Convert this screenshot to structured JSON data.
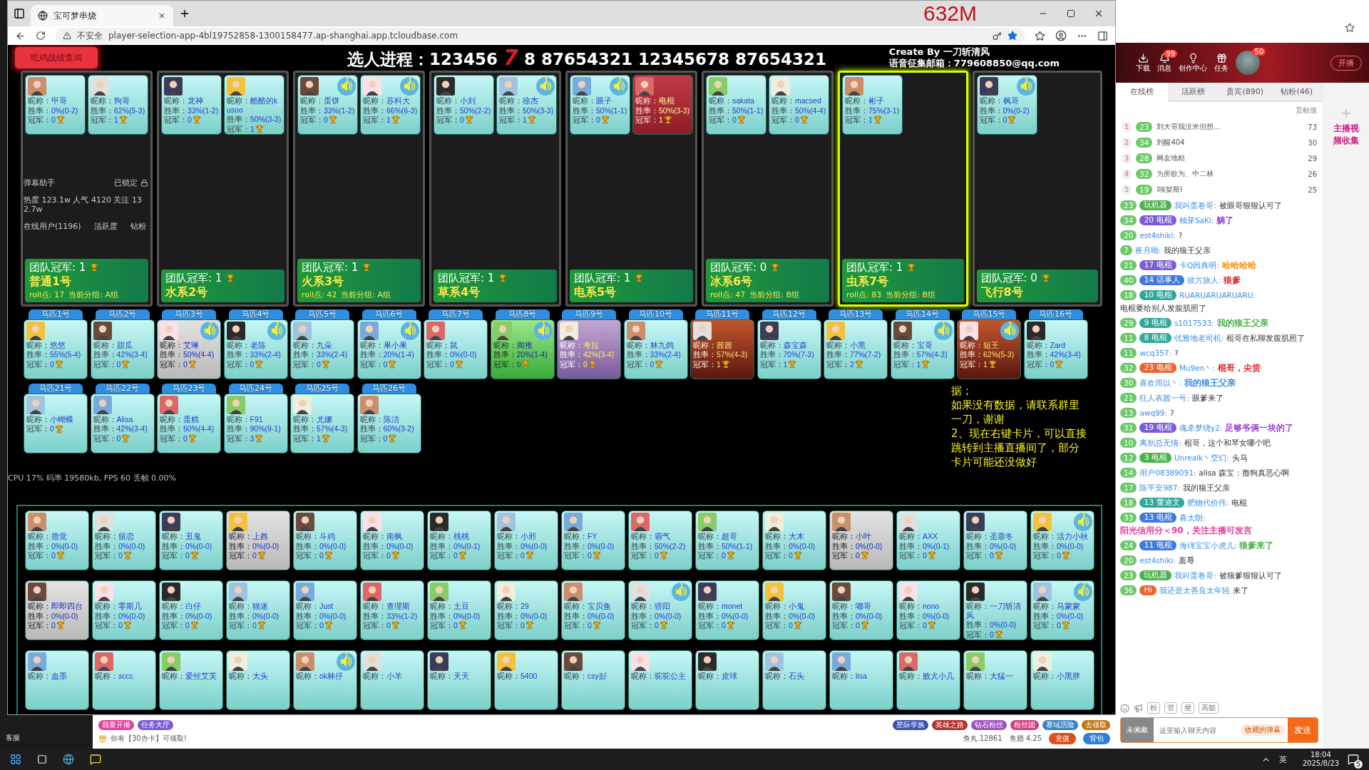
{
  "browser": {
    "tab_title": "宝可梦串烧",
    "memory_overlay": "632M",
    "security": "不安全",
    "url": "player-selection-app-4bl19752858-1300158477.ap-shanghai.app.tcloudbase.com"
  },
  "page": {
    "query_button": "吃鸡战绩查询",
    "progress_label": "选人进程：",
    "progress": [
      {
        "text": "123456",
        "highlight": false
      },
      {
        "text": "7",
        "highlight": true
      },
      {
        "text": "8 87654321 12345678 87654321",
        "highlight": false
      }
    ],
    "credit": "Create By 一刀斩清风",
    "email": "语音征集邮箱：779608850@qq.com"
  },
  "teams": [
    {
      "name": "普通1号",
      "champion": "团队冠军: 1",
      "roll": "roll点: 17",
      "group": "当前分组: A组",
      "selected": false,
      "players": [
        {
          "nick": "昵称：甲哥",
          "rate": "胜率：0%(0-2)",
          "champ": "冠军：0",
          "kind": "plain"
        },
        {
          "nick": "昵称：狗哥",
          "rate": "胜率：62%(5-3)",
          "champ": "冠军：1",
          "kind": "plain"
        }
      ]
    },
    {
      "name": "水系2号",
      "champion": "团队冠军: 1",
      "selected": false,
      "players": [
        {
          "nick": "昵称：龙神",
          "rate": "胜率：33%(1-2)",
          "champ": "冠军：0",
          "kind": "plain"
        },
        {
          "nick": "昵称：酷酷的kusoo",
          "rate": "胜率：50%(3-3)",
          "champ": "冠军：1",
          "kind": "plain"
        }
      ]
    },
    {
      "name": "火系3号",
      "champion": "团队冠军: 1",
      "roll": "roll点: 42",
      "group": "当前分组: A组",
      "selected": false,
      "players": [
        {
          "nick": "昵称：蛋饼",
          "rate": "胜率：33%(1-2)",
          "champ": "冠军：0",
          "voice": "1",
          "kind": "plain"
        },
        {
          "nick": "昵称：苏科大",
          "rate": "胜率：66%(6-3)",
          "champ": "冠军：1",
          "voice": "1",
          "kind": "plain"
        }
      ]
    },
    {
      "name": "草系4号",
      "champion": "团队冠军: 1",
      "selected": false,
      "players": [
        {
          "nick": "昵称：小刘",
          "rate": "胜率：50%(2-2)",
          "champ": "冠军：0",
          "kind": "plain"
        },
        {
          "nick": "昵称：徐杰",
          "rate": "胜率：50%(3-3)",
          "champ": "冠军：1",
          "voice": "1",
          "kind": "plain"
        }
      ]
    },
    {
      "name": "电系5号",
      "champion": "团队冠军: 1",
      "selected": false,
      "players": [
        {
          "nick": "昵称：眼子",
          "rate": "胜率：50%(1-1)",
          "champ": "冠军：0",
          "voice": "3",
          "kind": "plain"
        },
        {
          "nick": "昵称：电棍",
          "rate": "胜率：50%(3-3)",
          "champ": "冠军：1",
          "kind": "red"
        }
      ]
    },
    {
      "name": "冰系6号",
      "champion": "团队冠军: 0",
      "roll": "roll点: 47",
      "group": "当前分组: B组",
      "selected": false,
      "players": [
        {
          "nick": "昵称：sakata",
          "rate": "胜率：50%(1-1)",
          "champ": "冠军：0",
          "kind": "plain"
        },
        {
          "nick": "昵称：macsed",
          "rate": "胜率：50%(4-4)",
          "champ": "冠军：0",
          "kind": "plain"
        }
      ]
    },
    {
      "name": "虫系7号",
      "champion": "团队冠军: 1",
      "roll": "roll点: 83",
      "group": "当前分组: B组",
      "selected": true,
      "players": [
        {
          "nick": "昵称：彬子",
          "rate": "胜率：75%(3-1)",
          "champ": "冠军：1",
          "kind": "plain"
        }
      ]
    },
    {
      "name": "飞行8号",
      "champion": "团队冠军: 0",
      "selected": false,
      "players": [
        {
          "nick": "昵称：枫哥",
          "rate": "胜率：0%(0-2)",
          "champ": "冠军：0",
          "voice": "1",
          "kind": "plain"
        }
      ]
    }
  ],
  "horses": [
    {
      "tab": "马匹1号",
      "nick": "昵称：悠悠",
      "rate": "胜率：55%(5-4)",
      "champ": "冠军：0",
      "kind": "plain"
    },
    {
      "tab": "马匹2号",
      "nick": "昵称：甜瓜",
      "rate": "胜率：42%(3-4)",
      "champ": "冠军：0",
      "kind": "plain"
    },
    {
      "tab": "马匹3号",
      "nick": "昵称：艾琳",
      "rate": "胜率：50%(4-4)",
      "champ": "冠军：0",
      "voice": "2",
      "kind": "grey"
    },
    {
      "tab": "马匹4号",
      "nick": "昵称：老陈",
      "rate": "胜率：33%(2-4)",
      "champ": "冠军：0",
      "voice": "2",
      "kind": "plain"
    },
    {
      "tab": "马匹5号",
      "nick": "昵称：九朵",
      "rate": "胜率：33%(2-4)",
      "champ": "冠军：0",
      "kind": "plain"
    },
    {
      "tab": "马匹6号",
      "nick": "昵称：果小果",
      "rate": "胜率：20%(1-4)",
      "champ": "冠军：0",
      "voice": "1",
      "kind": "plain"
    },
    {
      "tab": "马匹7号",
      "nick": "昵称：鼠",
      "rate": "胜率：0%(0-0)",
      "champ": "冠军：0",
      "kind": "plain"
    },
    {
      "tab": "马匹8号",
      "nick": "昵称：闻推",
      "rate": "胜率：20%(1-4)",
      "champ": "冠军：0",
      "voice": "1",
      "kind": "green"
    },
    {
      "tab": "马匹9号",
      "nick": "昵称：考拉",
      "rate": "胜率：42%(3-4)",
      "champ": "冠军：0",
      "kind": "purple"
    },
    {
      "tab": "马匹10号",
      "nick": "昵称：林九鸽",
      "rate": "胜率：33%(2-4)",
      "champ": "冠军：0",
      "kind": "plain"
    },
    {
      "tab": "马匹11号",
      "nick": "昵称：茜茜",
      "rate": "胜率：57%(4-3)",
      "champ": "冠军：1",
      "kind": "fire"
    },
    {
      "tab": "马匹12号",
      "nick": "昵称：森宝森",
      "rate": "胜率：70%(7-3)",
      "champ": "冠军：1",
      "kind": "plain"
    },
    {
      "tab": "马匹13号",
      "nick": "昵称：小黑",
      "rate": "胜率：77%(7-2)",
      "champ": "冠军：2",
      "kind": "plain"
    },
    {
      "tab": "马匹14号",
      "nick": "昵称：宝哥",
      "rate": "胜率：57%(4-3)",
      "champ": "冠军：1",
      "voice": "1",
      "kind": "plain"
    },
    {
      "tab": "马匹15号",
      "nick": "昵称：短王",
      "rate": "胜率：62%(5-3)",
      "champ": "冠军：1",
      "voice": "1",
      "kind": "fire"
    },
    {
      "tab": "马匹16号",
      "nick": "昵称：Zard",
      "rate": "胜率：42%(3-4)",
      "champ": "冠军：0",
      "kind": "plain"
    }
  ],
  "horses_2": [
    {
      "tab": "马匹21号",
      "nick": "昵称：小蝴蝶",
      "champ": "冠军：0",
      "kind": "plain"
    },
    {
      "tab": "马匹22号",
      "nick": "昵称：Alisa",
      "rate": "胜率：42%(3-4)",
      "champ": "冠军：0",
      "kind": "plain"
    },
    {
      "tab": "马匹23号",
      "nick": "昵称：蛋糕",
      "rate": "胜率：50%(4-4)",
      "champ": "冠军：0",
      "kind": "plain"
    },
    {
      "tab": "马匹24号",
      "nick": "昵称：F91",
      "rate": "胜率：90%(9-1)",
      "champ": "冠军：3",
      "kind": "plain"
    },
    {
      "tab": "马匹25号",
      "nick": "昵称：尤娜",
      "rate": "胜率：57%(4-3)",
      "champ": "冠军：1",
      "kind": "plain"
    },
    {
      "tab": "马匹26号",
      "nick": "昵称：陈洁",
      "rate": "胜率：60%(3-2)",
      "champ": "冠军：0",
      "kind": "plain"
    }
  ],
  "notice": [
    "据；",
    "如果没有数据，请联系群里一刀，谢谢",
    "2、现在右键卡片，可以直接跳转到主播直播间了，部分卡片可能还没做好"
  ],
  "pool": [
    {
      "nick": "昵称：措觉",
      "rate": "胜率：0%(0-0)",
      "champ": "冠军：0",
      "kind": "plain"
    },
    {
      "nick": "昵称：留恋",
      "rate": "胜率：0%(0-0)",
      "champ": "冠军：0",
      "kind": "plain"
    },
    {
      "nick": "昵称：丑鬼",
      "rate": "胜率：0%(0-0)",
      "champ": "冠军：0",
      "kind": "plain"
    },
    {
      "nick": "昵称：上酋",
      "rate": "胜率：0%(0-0)",
      "champ": "冠军：0",
      "kind": "grey"
    },
    {
      "nick": "昵称：斗鸡",
      "rate": "胜率：0%(0-0)",
      "champ": "冠军：0",
      "kind": "plain"
    },
    {
      "nick": "昵称：南枫",
      "rate": "胜率：0%(0-0)",
      "champ": "冠军：0",
      "kind": "plain"
    },
    {
      "nick": "昵称：桃桃",
      "rate": "胜率：0%(0-1)",
      "champ": "冠军：0",
      "kind": "plain"
    },
    {
      "nick": "昵称：小邪",
      "rate": "胜率：0%(0-0)",
      "champ": "冠军：0",
      "kind": "plain"
    },
    {
      "nick": "昵称：FY",
      "rate": "胜率：0%(0-0)",
      "champ": "冠军：0",
      "kind": "plain"
    },
    {
      "nick": "昵称：霸气",
      "rate": "胜率：50%(2-2)",
      "champ": "冠军：0",
      "kind": "plain"
    },
    {
      "nick": "昵称：超哥",
      "rate": "胜率：50%(1-1)",
      "champ": "冠军：0",
      "kind": "plain"
    },
    {
      "nick": "昵称：大木",
      "rate": "胜率：0%(0-0)",
      "champ": "冠军：0",
      "kind": "plain"
    },
    {
      "nick": "昵称：小叶",
      "rate": "胜率：0%(0-0)",
      "champ": "冠军：0",
      "kind": "grey"
    },
    {
      "nick": "昵称：AXX",
      "rate": "胜率：0%(0-1)",
      "champ": "冠军：0",
      "kind": "plain"
    },
    {
      "nick": "昵称：圣蓉冬",
      "rate": "胜率：0%(0-0)",
      "champ": "冠军：0",
      "kind": "plain"
    },
    {
      "nick": "昵称：活力小秋",
      "rate": "胜率：0%(0-0)",
      "champ": "冠军：0",
      "voice": "1",
      "kind": "plain"
    },
    {
      "nick": "昵称：即即四台",
      "rate": "胜率：0%(0-0)",
      "champ": "冠军：0",
      "kind": "grey"
    },
    {
      "nick": "昵称：零斯几",
      "rate": "胜率：0%(0-0)",
      "champ": "冠军：0",
      "kind": "plain"
    },
    {
      "nick": "昵称：白仔",
      "rate": "胜率：0%(0-0)",
      "champ": "冠军：0",
      "kind": "plain"
    },
    {
      "nick": "昵称：猫迷",
      "rate": "胜率：0%(0-0)",
      "champ": "冠军：0",
      "kind": "plain"
    },
    {
      "nick": "昵称：Just",
      "rate": "胜率：0%(0-0)",
      "champ": "冠军：0",
      "kind": "plain"
    },
    {
      "nick": "昵称：查理斯",
      "rate": "胜率：33%(1-2)",
      "champ": "冠军：0",
      "kind": "plain"
    },
    {
      "nick": "昵称：土豆",
      "rate": "胜率：0%(0-0)",
      "champ": "冠军：0",
      "kind": "plain"
    },
    {
      "nick": "昵称：29",
      "rate": "胜率：0%(0-0)",
      "champ": "冠军：0",
      "kind": "plain"
    },
    {
      "nick": "昵称：宝贝鱼",
      "rate": "胜率：0%(0-0)",
      "champ": "冠军：0",
      "kind": "plain"
    },
    {
      "nick": "昵称：骄阳",
      "rate": "胜率：0%(0-0)",
      "champ": "冠军：0",
      "voice": "1",
      "kind": "plain"
    },
    {
      "nick": "昵称：monet",
      "rate": "胜率：0%(0-0)",
      "champ": "冠军：0",
      "kind": "plain"
    },
    {
      "nick": "昵称：小鬼",
      "rate": "胜率：0%(0-0)",
      "champ": "冠军：0",
      "kind": "plain"
    },
    {
      "nick": "昵称：嘟哥",
      "rate": "胜率：0%(0-0)",
      "champ": "冠军：0",
      "kind": "plain"
    },
    {
      "nick": "昵称：nono",
      "rate": "胜率：0%(0-0)",
      "champ": "冠军：0",
      "kind": "plain"
    },
    {
      "nick": "昵称：一刀斩清风",
      "rate": "胜率：0%(0-0)",
      "champ": "冠军：0",
      "kind": "plain"
    },
    {
      "nick": "昵称：马蒙蒙",
      "rate": "胜率：0%(0-0)",
      "champ": "冠军：0",
      "voice": "2",
      "kind": "plain"
    },
    {
      "nick": "昵称：血墨",
      "kind": "plain"
    },
    {
      "nick": "昵称：sccc",
      "kind": "plain"
    },
    {
      "nick": "昵称：爱丝艾芙",
      "kind": "plain"
    },
    {
      "nick": "昵称：大头",
      "kind": "plain"
    },
    {
      "nick": "昵称：ok林仔",
      "voice": "1",
      "kind": "plain"
    },
    {
      "nick": "昵称：小羊",
      "kind": "plain"
    },
    {
      "nick": "昵称：天天",
      "kind": "plain"
    },
    {
      "nick": "昵称：5400",
      "kind": "plain"
    },
    {
      "nick": "昵称：csy彭",
      "kind": "plain"
    },
    {
      "nick": "昵称：驼驼公主",
      "kind": "plain"
    },
    {
      "nick": "昵称：皮球",
      "kind": "plain"
    },
    {
      "nick": "昵称：石头",
      "kind": "plain"
    },
    {
      "nick": "昵称：lisa",
      "kind": "plain"
    },
    {
      "nick": "昵称：败犬小几",
      "kind": "plain"
    },
    {
      "nick": "昵称：大猛一",
      "kind": "plain"
    },
    {
      "nick": "昵称：小黑胖",
      "kind": "plain"
    }
  ],
  "stream_overlay": {
    "title": "弹幕助手",
    "lock": "已锁定",
    "stats": "热度 123.1w 人气 4120 关注 132.7w",
    "tabs": [
      "在线用户(1196)",
      "活跃度",
      "钻粉"
    ],
    "perf": "CPU 17% 码率 19580kb, FPS 60 丢帧 0.00%"
  },
  "live_app": {
    "header": [
      {
        "label": "下载",
        "kind": "download"
      },
      {
        "label": "消息",
        "kind": "bell",
        "badge": "99"
      },
      {
        "label": "创作中心",
        "kind": "bulb"
      },
      {
        "label": "任务",
        "kind": "gift"
      }
    ],
    "avatar_badge": "50",
    "start_button": "开播",
    "tabs": [
      {
        "label": "在线榜",
        "selected": true
      },
      {
        "label": "活跃榜",
        "selected": false
      },
      {
        "label": "贵宾(890)",
        "selected": false
      },
      {
        "label": "钻粉(46)",
        "selected": false
      }
    ],
    "rank_header": "贡献值",
    "ranks": [
      {
        "rank": "1",
        "level": "23",
        "name": "刘大哥我没米但想...",
        "value": "73"
      },
      {
        "rank": "2",
        "level": "34",
        "name": "刘醒404",
        "value": "30"
      },
      {
        "rank": "3",
        "level": "28",
        "name": "网友地精",
        "value": "29"
      },
      {
        "rank": "4",
        "level": "32",
        "name": "为所欲为、中二林",
        "value": "26"
      },
      {
        "rank": "5",
        "level": "19",
        "name": "I埃桀斯I",
        "value": "25"
      }
    ],
    "messages": [
      {
        "level": "23",
        "badge": {
          "name": "玩机器",
          "color": "#4caf50"
        },
        "user": "我叫蛋卷哥:",
        "text": "被眼哥狠狠认可了"
      },
      {
        "level": "34",
        "badge": {
          "level": "20",
          "name": "电棍",
          "color": "#7b5cd6"
        },
        "user": "柚芽SaKi:",
        "text": "躺了",
        "color": "#9b3fd1"
      },
      {
        "level": "20",
        "user": "est4shiki:",
        "text": "?"
      },
      {
        "level": "7",
        "user": "夜月呦:",
        "text": "我的狼王父亲"
      },
      {
        "level": "21",
        "badge": {
          "level": "17",
          "name": "电棍",
          "color": "#7b5cd6"
        },
        "user": "卡Q因典明:",
        "text": "哈哈哈哈",
        "color": "#f08a00"
      },
      {
        "level": "40",
        "badge": {
          "level": "14",
          "name": "话事人",
          "color": "#3d7be0"
        },
        "user": "彼方旅人:",
        "text": "狼爹",
        "color": "#e0262b"
      },
      {
        "level": "18",
        "badge": {
          "level": "10",
          "name": "电棍",
          "color": "#2fa89a"
        },
        "user": "RUARUARUARUARU:",
        "text": "电棍要给别人发腹肌照了"
      },
      {
        "level": "29",
        "badge": {
          "level": "9",
          "name": "电棍",
          "color": "#2fa89a"
        },
        "user": "s1017533:",
        "text": "我的狼王父亲",
        "color": "#48b248"
      },
      {
        "level": "11",
        "badge": {
          "level": "8",
          "name": "电棍",
          "color": "#2fa89a"
        },
        "user": "优雅地老司机:",
        "text": "棍哥在私聊发腹肌照了"
      },
      {
        "level": "11",
        "user": "wcq357:",
        "text": "?"
      },
      {
        "level": "32",
        "badge": {
          "level": "23",
          "name": "电棍",
          "color": "#e9642b"
        },
        "user": "Mu9en丶:",
        "text": "棍哥，尖货",
        "color": "#e0262b"
      },
      {
        "level": "30",
        "user": "喜欢而以丶:",
        "text": "我的狼王父亲",
        "color": "#3a8ee6"
      },
      {
        "level": "21",
        "user": "狂人表茜一号:",
        "text": "眼爹来了"
      },
      {
        "level": "13",
        "user": "awq99:",
        "text": "?"
      },
      {
        "level": "31",
        "badge": {
          "level": "19",
          "name": "电棍",
          "color": "#7b5cd6"
        },
        "user": "魂牵梦绕y2:",
        "text": "足够爷俩一块的了",
        "color": "#9b3fd1"
      },
      {
        "level": "10",
        "user": "离别总无情:",
        "text": "棍哥，这个和琴女哪个吧"
      },
      {
        "level": "12",
        "badge": {
          "level": "3",
          "name": "电棍",
          "color": "#48b248"
        },
        "user": "Unrealk丶空幻:",
        "text": "头马"
      },
      {
        "level": "14",
        "user": "用户08389091:",
        "text": "alisa 森宝：撸狗真恶心啊"
      },
      {
        "level": "17",
        "user": "陈平安987:",
        "text": "我的狼王父亲"
      },
      {
        "level": "18",
        "badge": {
          "level": "13",
          "name": "蕾迪文",
          "color": "#2fa89a"
        },
        "user": "肥物代价伟:",
        "text": "电棍"
      },
      {
        "level": "33",
        "badge": {
          "level": "13",
          "name": "电棍",
          "color": "#3d7be0"
        },
        "user": "喜太朗:",
        "text": "阳光信用分＜90，关注主播可发言",
        "color": "#e0409a"
      },
      {
        "level": "24",
        "badge": {
          "level": "11",
          "name": "电棍",
          "color": "#3d7be0"
        },
        "user": "海绵宝宝小虎儿:",
        "text": "狼爹来了",
        "color": "#48b248"
      },
      {
        "level": "20",
        "user": "est4shiki:",
        "text": "羞辱"
      },
      {
        "level": "23",
        "badge": {
          "name": "玩机器",
          "color": "#4caf50"
        },
        "user": "我叫蛋卷哥:",
        "text": "被狼爹狠狠认可了"
      },
      {
        "level": "36",
        "badge": {
          "name": "Hi",
          "color": "#e9642b"
        },
        "user": "我还是太善良太年轻",
        "text": "来了"
      }
    ],
    "side_art": "主播视频收集",
    "tools": [
      "粉",
      "管",
      "梗",
      "高能"
    ],
    "wear_badge": "未佩戴",
    "input_placeholder": "这里输入聊天内容",
    "saved_danmaku": "收藏的弹幕",
    "send": "发送"
  },
  "bottom_strip": {
    "service": "客服",
    "left_tags": [
      "我要开播",
      "任务大厅"
    ],
    "right_tags": [
      "星际孪换",
      "英雄之路",
      "钻石粉丝",
      "粉丝团",
      "赛域历险",
      "去领取"
    ],
    "notice": "你有【30办卡】可领取!",
    "fish_ball": "鱼丸 12861",
    "fish_fin": "鱼翅 4.25",
    "recharge": "充值",
    "backpack": "背包"
  },
  "taskbar": {
    "ime": "英",
    "time": "18:04",
    "date": "2025/8/23",
    "notifications": "5"
  }
}
